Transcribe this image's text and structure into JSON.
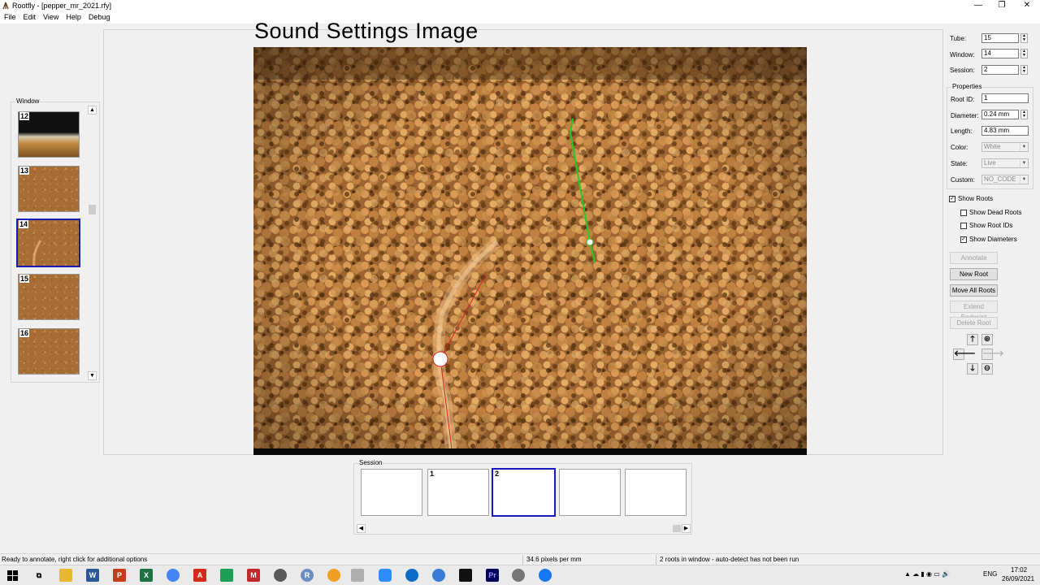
{
  "window": {
    "title": "Rootfly - [pepper_mr_2021.rfy]",
    "controls": {
      "minimize": "—",
      "restore": "❐",
      "close": "✕"
    }
  },
  "menu": {
    "items": [
      "File",
      "Edit",
      "View",
      "Help",
      "Debug"
    ]
  },
  "image_overlay_menu": "Sound   Settings   Image",
  "window_group": {
    "label": "Window",
    "thumbnails": [
      {
        "number": "12",
        "selected": false
      },
      {
        "number": "13",
        "selected": false
      },
      {
        "number": "14",
        "selected": true
      },
      {
        "number": "15",
        "selected": false
      },
      {
        "number": "16",
        "selected": false
      }
    ]
  },
  "controls": {
    "tube_label": "Tube:",
    "tube_value": "15",
    "window_label": "Window:",
    "window_value": "14",
    "session_label": "Session:",
    "session_value": "2"
  },
  "properties": {
    "label": "Properties",
    "root_id_label": "Root ID:",
    "root_id_value": "1",
    "diameter_label": "Diameter:",
    "diameter_value": "0.24 mm",
    "length_label": "Length:",
    "length_value": "4.83 mm",
    "color_label": "Color:",
    "color_value": "White",
    "state_label": "State:",
    "state_value": "Live",
    "custom_label": "Custom:",
    "custom_value": "NO_CODE"
  },
  "options": {
    "show_roots": {
      "label": "Show Roots",
      "checked": true
    },
    "show_dead_roots": {
      "label": "Show Dead Roots",
      "checked": false
    },
    "show_root_ids": {
      "label": "Show Root IDs",
      "checked": false
    },
    "show_diameters": {
      "label": "Show Diameters",
      "checked": true
    }
  },
  "buttons": {
    "annotate": "Annotate",
    "new_root": "New Root",
    "move_all_roots": "Move All Roots",
    "extend_endpoint": "Extend Endpoint",
    "delete_root": "Delete Root"
  },
  "nav_icons": {
    "up": "🡑",
    "left": "🡐",
    "right": "🡒",
    "down": "🡓",
    "zoom_in": "⊕",
    "zoom_out": "⊖"
  },
  "session_group": {
    "label": "Session",
    "slots": [
      {
        "number": "",
        "has_image": false,
        "selected": false
      },
      {
        "number": "1",
        "has_image": true,
        "selected": false
      },
      {
        "number": "2",
        "has_image": true,
        "selected": true
      },
      {
        "number": "",
        "has_image": false,
        "selected": false
      },
      {
        "number": "",
        "has_image": false,
        "selected": false
      }
    ]
  },
  "status": {
    "left": "Ready to annotate, right click for additional options",
    "middle": "34.6 pixels per mm",
    "right": "2 roots in window - auto-detect has not been run"
  },
  "taskbar": {
    "language": "ENG",
    "time": "17:02",
    "date": "26/09/2021"
  },
  "colors": {
    "selection_border": "#1a1ab8",
    "root_red": "#e02020",
    "root_green": "#22cc22",
    "soil": "#a46a32"
  }
}
